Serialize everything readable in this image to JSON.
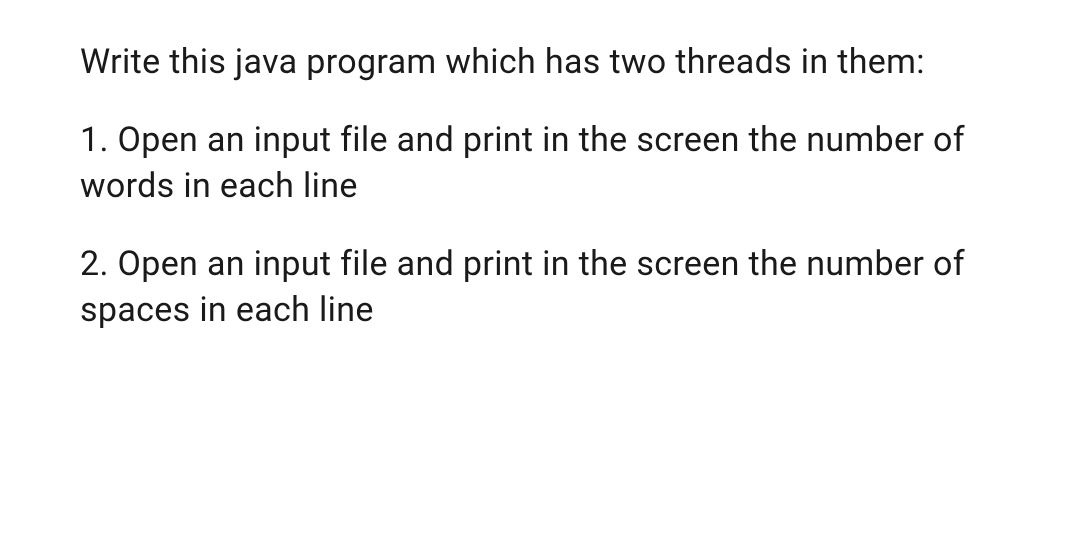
{
  "paragraphs": {
    "intro": "Write this java program which has two threads in them:",
    "item1": "1. Open an input file and print in the screen the number of words in each line",
    "item2": "2. Open an input file and print in the screen the number of spaces in each line"
  }
}
